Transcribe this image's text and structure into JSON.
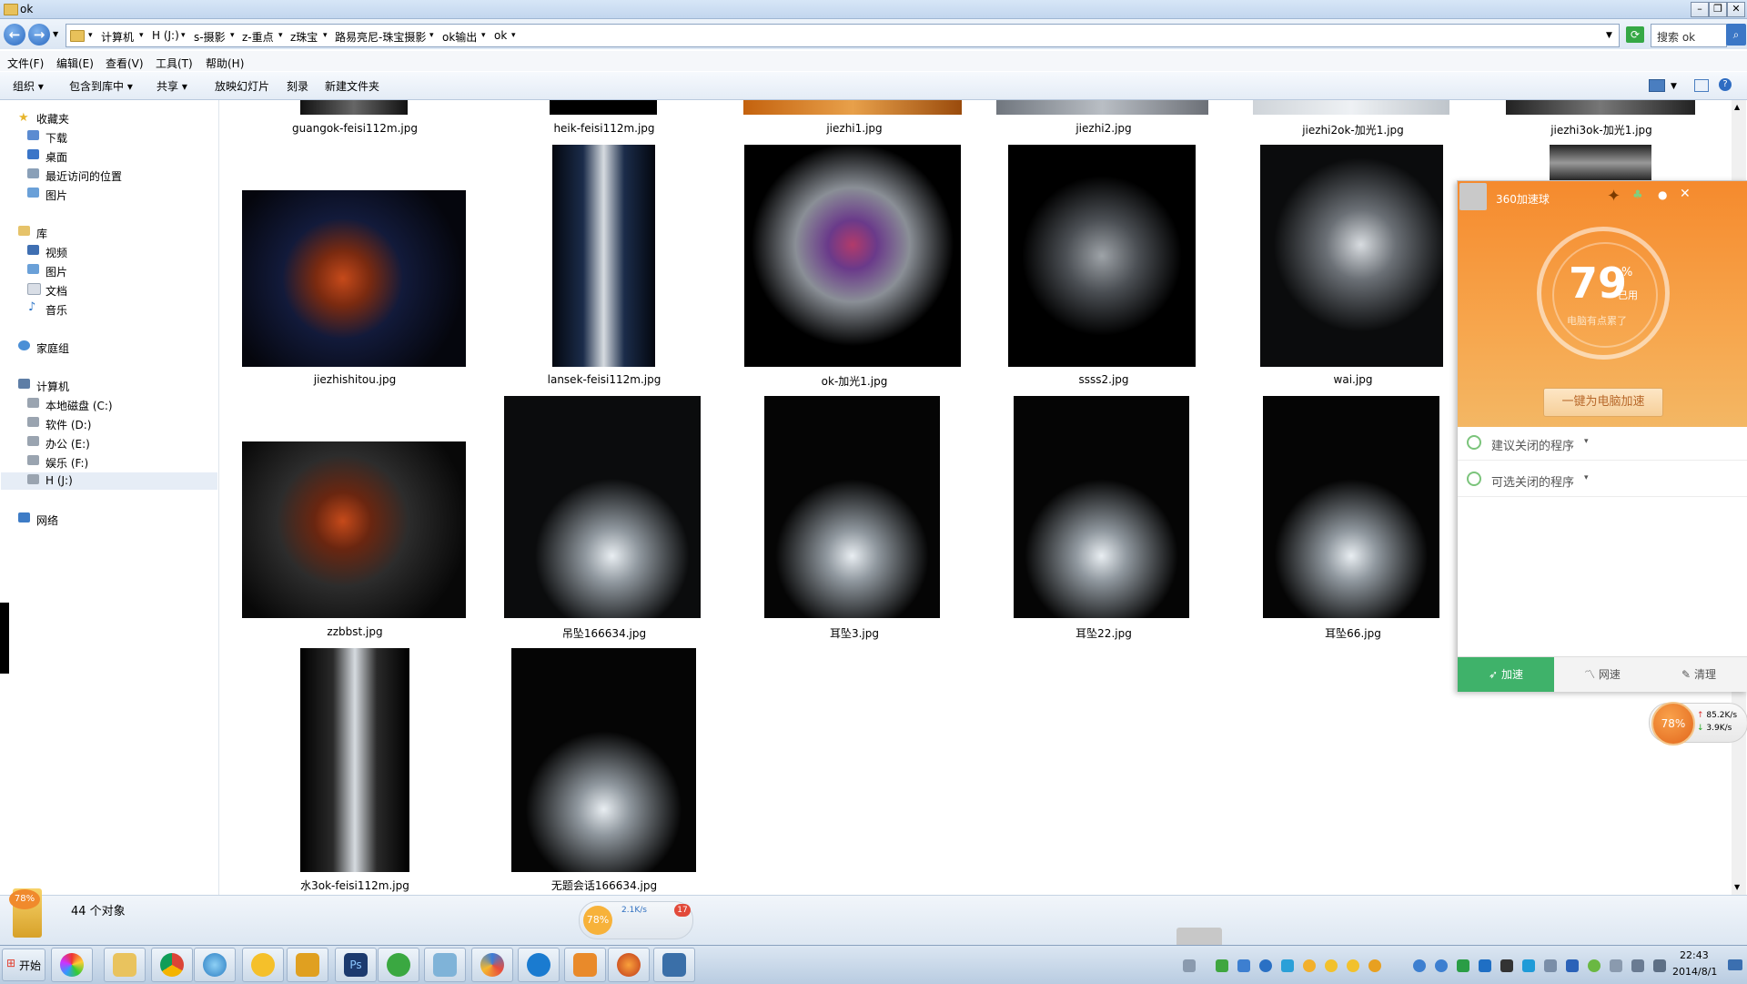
{
  "window": {
    "title": "ok",
    "controls": [
      "minimize",
      "maximize",
      "close"
    ]
  },
  "address": {
    "breadcrumbs": [
      "计算机",
      "H (J:)",
      "s-摄影",
      "z-重点",
      "z珠宝",
      "路易亮尼-珠宝摄影",
      "ok输出",
      "ok"
    ],
    "search_placeholder": "搜索 ok"
  },
  "menu": [
    "文件(F)",
    "编辑(E)",
    "查看(V)",
    "工具(T)",
    "帮助(H)"
  ],
  "toolbar": {
    "organize": "组织",
    "include_library": "包含到库中",
    "share": "共享",
    "slideshow": "放映幻灯片",
    "burn": "刻录",
    "new_folder": "新建文件夹"
  },
  "nav": {
    "favorites": {
      "label": "收藏夹",
      "items": [
        "下载",
        "桌面",
        "最近访问的位置",
        "图片"
      ]
    },
    "libraries": {
      "label": "库",
      "items": [
        "视频",
        "图片",
        "文档",
        "音乐"
      ]
    },
    "homegroup": "家庭组",
    "computer": {
      "label": "计算机",
      "items": [
        "本地磁盘 (C:)",
        "软件 (D:)",
        "办公 (E:)",
        "娱乐 (F:)",
        "H (J:)"
      ]
    },
    "network": "网络"
  },
  "files": {
    "row0": [
      "guangok-feisi112m.jpg",
      "heik-feisi112m.jpg",
      "jiezhi1.jpg",
      "jiezhi2.jpg",
      "jiezhi2ok-加光1.jpg",
      "jiezhi3ok-加光1.jpg"
    ],
    "row1": [
      "jiezhishitou.jpg",
      "lansek-feisi112m.jpg",
      "ok-加光1.jpg",
      "ssss2.jpg",
      "wai.jpg"
    ],
    "row2": [
      "zzbbst.jpg",
      "吊坠166634.jpg",
      "耳坠3.jpg",
      "耳坠22.jpg",
      "耳坠66.jpg"
    ],
    "row3": [
      "水3ok-feisi112m.jpg",
      "无题会话166634.jpg"
    ]
  },
  "status": {
    "count": "44 个对象",
    "widget_percent": "78%",
    "widget_speed": "2.1K/s",
    "widget_badge": "17"
  },
  "panel360": {
    "title": "360加速球",
    "percent": "79",
    "percent_sign": "%",
    "used": "已用",
    "message": "电脑有点累了",
    "accelerate_button": "一键为电脑加速",
    "rows": [
      "建议关闭的程序",
      "可选关闭的程序"
    ],
    "tabs": [
      "加速",
      "网速",
      "清理"
    ]
  },
  "ball": {
    "percent": "78%",
    "up": "85.2K/s",
    "down": "3.9K/s"
  },
  "taskbar": {
    "start": "开始",
    "time": "22:43",
    "date": "2014/8/1"
  },
  "colors": {
    "accent_360": "#f58a2d",
    "tab_active": "#3fb26a",
    "explorer_bar": "#dbe6f3"
  }
}
